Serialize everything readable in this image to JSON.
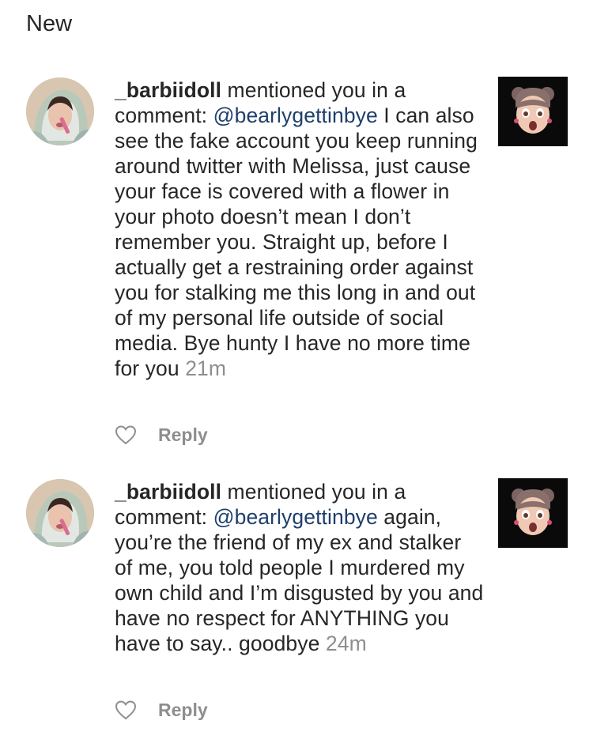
{
  "header": {
    "title": "New"
  },
  "notifications": [
    {
      "username": "_barbiidoll",
      "action_text": " mentioned you in a comment: ",
      "mention": "@bearlygettinbye",
      "comment": " I can also see the fake account you keep running around twitter with Melissa, just cause your face is covered with a flower in your photo doesn’t mean I don’t remember you. Straight up, before I actually get a restraining order against you for stalking me this long in and out of my personal life outside of social media. Bye hunty I have no more time for you",
      "time": "21m",
      "reply_label": "Reply"
    },
    {
      "username": "_barbiidoll",
      "action_text": " mentioned you in a comment: ",
      "mention": "@bearlygettinbye",
      "comment": " again, you’re the friend of my ex and stalker of me, you told people I murdered my own child and I’m disgusted by you and have no respect for ANYTHING you have to say.. goodbye",
      "time": "24m",
      "reply_label": "Reply"
    }
  ],
  "icons": {
    "like": "heart-outline-icon"
  },
  "colors": {
    "mention": "#1f3f6b",
    "muted": "#8e8e8e",
    "text": "#262626",
    "thumb_bg": "#0a0a0a"
  }
}
